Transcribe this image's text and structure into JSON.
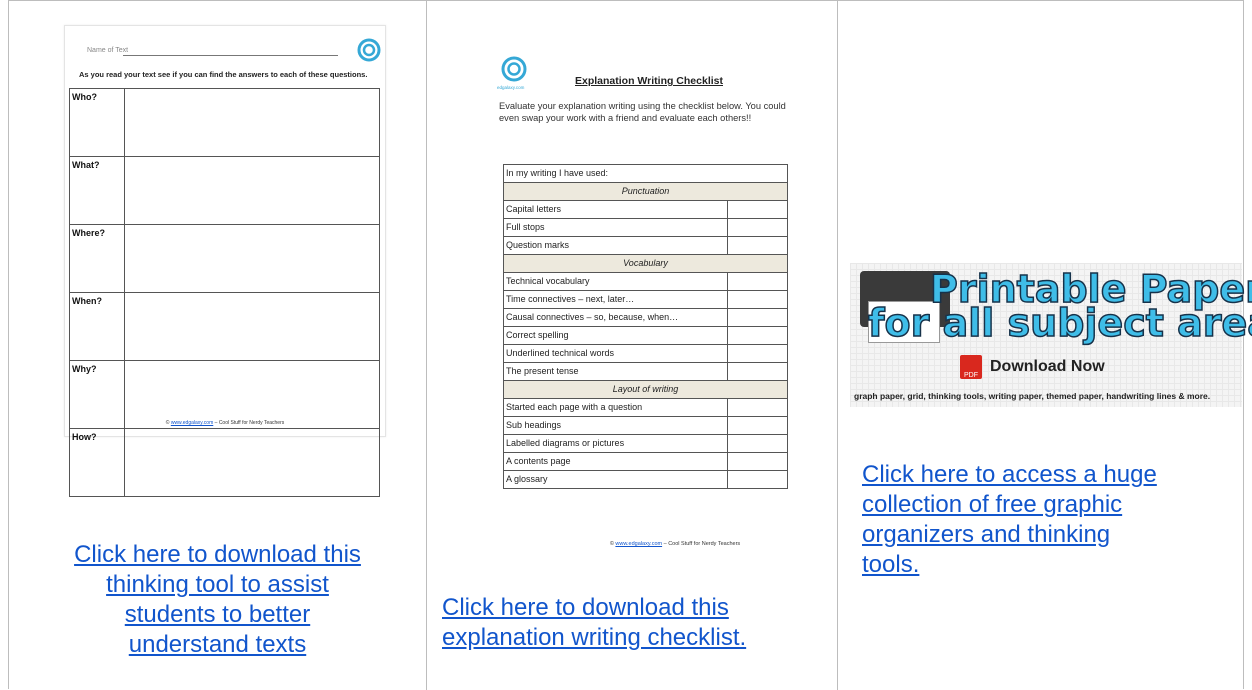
{
  "col1": {
    "doc": {
      "name_label": "Name of Text",
      "instruction": "As you read your text see if you can find the answers to each of these questions.",
      "questions": [
        "Who?",
        "What?",
        "Where?",
        "When?",
        "Why?",
        "How?"
      ],
      "footer_prefix": "© ",
      "footer_url": "www.edgalaxy.com",
      "footer_suffix": " – Cool Stuff for Nerdy Teachers"
    },
    "link_lines": [
      "Click here to download this",
      "thinking tool to assist",
      "students to better",
      "understand texts"
    ]
  },
  "col2": {
    "doc": {
      "logo_text": "edgalaxy.com",
      "title": "Explanation Writing Checklist",
      "intro": "Evaluate your explanation writing using the checklist below. You could even swap your work with a friend and evaluate each others!!",
      "rows": [
        {
          "text": "In my writing I have used:",
          "type": "head"
        },
        {
          "text": "Punctuation",
          "type": "section"
        },
        {
          "text": "Capital letters",
          "type": "item"
        },
        {
          "text": "Full stops",
          "type": "item"
        },
        {
          "text": "Question marks",
          "type": "item"
        },
        {
          "text": "Vocabulary",
          "type": "section"
        },
        {
          "text": "Technical vocabulary",
          "type": "item"
        },
        {
          "text": "Time connectives – next, later…",
          "type": "item"
        },
        {
          "text": "Causal connectives – so, because, when…",
          "type": "item"
        },
        {
          "text": "Correct spelling",
          "type": "item"
        },
        {
          "text": "Underlined technical words",
          "type": "item"
        },
        {
          "text": "The present tense",
          "type": "item"
        },
        {
          "text": "Layout of writing",
          "type": "section"
        },
        {
          "text": "Started each page with a question",
          "type": "item"
        },
        {
          "text": "Sub headings",
          "type": "item"
        },
        {
          "text": "Labelled diagrams or pictures",
          "type": "item"
        },
        {
          "text": "A contents page",
          "type": "item"
        },
        {
          "text": "A glossary",
          "type": "item"
        }
      ],
      "footer_prefix": "© ",
      "footer_url": "www.edgalaxy.com",
      "footer_suffix": " – Cool Stuff for Nerdy Teachers"
    },
    "link_lines": [
      "Click here to download this",
      "explanation writing checklist."
    ]
  },
  "col3": {
    "banner": {
      "title_line1": "Printable Paper",
      "title_line2": "for all subject areas",
      "download": "Download Now",
      "pdf_label": "PDF",
      "caption": "graph paper, grid, thinking tools, writing paper, themed paper, handwriting lines & more."
    },
    "link_lines": [
      "Click here to access a huge",
      "collection of free graphic",
      "organizers and thinking",
      "tools."
    ]
  },
  "colors": {
    "link": "#1155cc",
    "border": "#bdbdbd",
    "banner_text": "#3fbde8",
    "pdf": "#d9281e"
  }
}
